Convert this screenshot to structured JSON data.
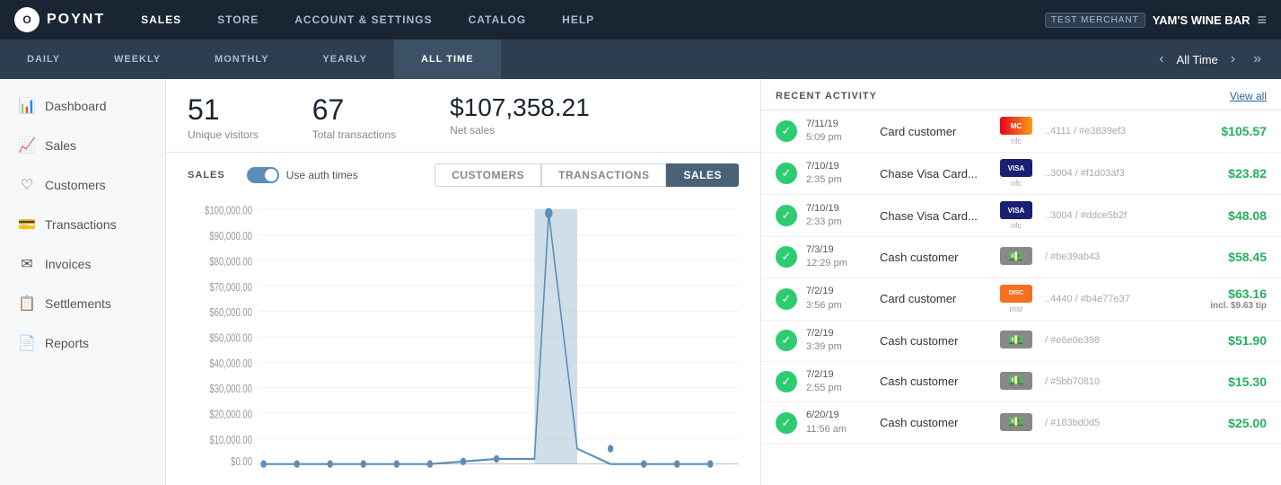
{
  "topNav": {
    "logo": "O",
    "logoText": "POYNT",
    "items": [
      "SALES",
      "STORE",
      "ACCOUNT & SETTINGS",
      "CATALOG",
      "HELP"
    ],
    "activeItem": "SALES",
    "testMerchant": "TEST MERCHANT",
    "merchantName": "YAM'S WINE BAR"
  },
  "timeTabs": {
    "tabs": [
      "DAILY",
      "WEEKLY",
      "MONTHLY",
      "YEARLY",
      "ALL TIME"
    ],
    "activeTab": "ALL TIME",
    "currentPeriod": "All Time"
  },
  "sidebar": {
    "items": [
      {
        "id": "dashboard",
        "label": "Dashboard",
        "icon": "📊"
      },
      {
        "id": "sales",
        "label": "Sales",
        "icon": "📈"
      },
      {
        "id": "customers",
        "label": "Customers",
        "icon": "♡"
      },
      {
        "id": "transactions",
        "label": "Transactions",
        "icon": "💳"
      },
      {
        "id": "invoices",
        "label": "Invoices",
        "icon": "✉"
      },
      {
        "id": "settlements",
        "label": "Settlements",
        "icon": "📋"
      },
      {
        "id": "reports",
        "label": "Reports",
        "icon": "📄"
      }
    ]
  },
  "stats": {
    "uniqueVisitors": {
      "value": "51",
      "label": "Unique visitors"
    },
    "totalTransactions": {
      "value": "67",
      "label": "Total transactions"
    },
    "netSales": {
      "value": "$107,358.21",
      "label": "Net sales"
    }
  },
  "chart": {
    "sectionTitle": "SALES",
    "toggleLabel": "Use auth times",
    "tabs": [
      "CUSTOMERS",
      "TRANSACTIONS",
      "SALES"
    ],
    "activeTab": "SALES",
    "yLabels": [
      "$100,000.00",
      "$90,000.00",
      "$80,000.00",
      "$70,000.00",
      "$60,000.00",
      "$50,000.00",
      "$40,000.00",
      "$30,000.00",
      "$20,000.00",
      "$10,000.00",
      "$0.00"
    ]
  },
  "recentActivity": {
    "title": "RECENT ACTIVITY",
    "viewAllLabel": "View all",
    "items": [
      {
        "date": "7/11/19",
        "time": "5:09 pm",
        "customer": "Card customer",
        "cardType": "mastercard",
        "cardLabel": "MC",
        "nfc": "nfc",
        "ref": "..4111 / #e3839ef3",
        "amount": "$105.57",
        "tip": ""
      },
      {
        "date": "7/10/19",
        "time": "2:35 pm",
        "customer": "Chase Visa Card...",
        "cardType": "visa",
        "cardLabel": "VISA",
        "nfc": "nfc",
        "ref": "..3004 / #f1d03af3",
        "amount": "$23.82",
        "tip": ""
      },
      {
        "date": "7/10/19",
        "time": "2:33 pm",
        "customer": "Chase Visa Card...",
        "cardType": "visa",
        "cardLabel": "VISA",
        "nfc": "nfc",
        "ref": "..3004 / #ddce5b2f",
        "amount": "$48.08",
        "tip": ""
      },
      {
        "date": "7/3/19",
        "time": "12:29 pm",
        "customer": "Cash customer",
        "cardType": "cash",
        "cardLabel": "$",
        "nfc": "",
        "ref": "/ #be39ab43",
        "amount": "$58.45",
        "tip": ""
      },
      {
        "date": "7/2/19",
        "time": "3:56 pm",
        "customer": "Card customer",
        "cardType": "discover",
        "cardLabel": "DISC",
        "nfc": "msr",
        "ref": "..4440 / #b4e77e37",
        "amount": "$63.16",
        "tip": "incl. $9.63 tip"
      },
      {
        "date": "7/2/19",
        "time": "3:39 pm",
        "customer": "Cash customer",
        "cardType": "cash",
        "cardLabel": "$",
        "nfc": "",
        "ref": "/ #e6e0e398",
        "amount": "$51.90",
        "tip": ""
      },
      {
        "date": "7/2/19",
        "time": "2:55 pm",
        "customer": "Cash customer",
        "cardType": "cash",
        "cardLabel": "$",
        "nfc": "",
        "ref": "/ #5bb70810",
        "amount": "$15.30",
        "tip": ""
      },
      {
        "date": "6/20/19",
        "time": "11:56 am",
        "customer": "Cash customer",
        "cardType": "cash",
        "cardLabel": "$",
        "nfc": "",
        "ref": "/ #183bd0d5",
        "amount": "$25.00",
        "tip": ""
      }
    ]
  }
}
